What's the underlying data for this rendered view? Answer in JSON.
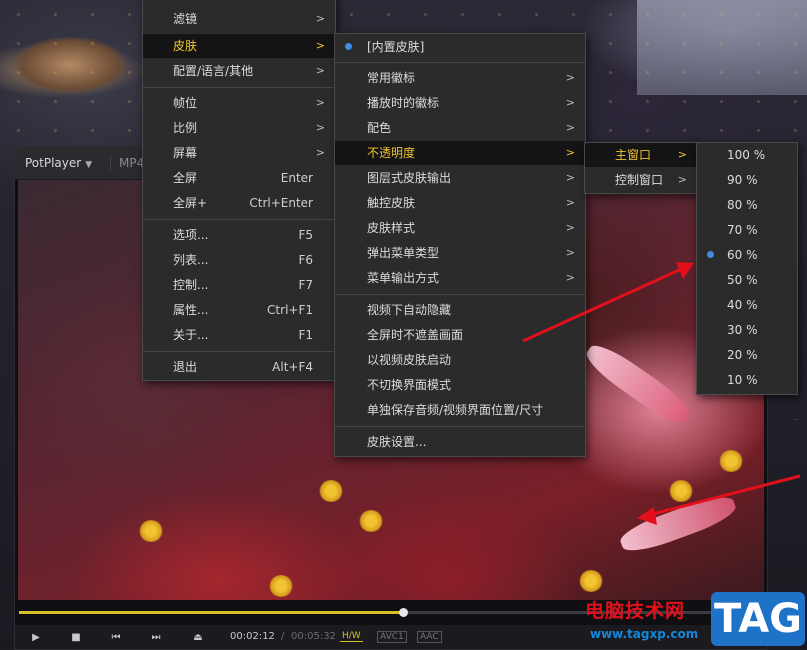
{
  "player": {
    "title": "PotPlayer",
    "format": "MP4",
    "time_current": "00:02:12",
    "time_separator": "/",
    "time_total": "00:05:32",
    "tag_hw": "H/W",
    "tag_video": "AVC1",
    "tag_audio": "AAC",
    "progress_fraction": 0.52
  },
  "main_menu": {
    "items": [
      {
        "label": "滤镜",
        "shortcut": "",
        "submenu": true
      },
      {
        "label": "皮肤",
        "shortcut": "",
        "submenu": true,
        "highlighted": true
      },
      {
        "label": "配置/语言/其他",
        "shortcut": "",
        "submenu": true
      },
      {
        "label": "帧位",
        "shortcut": "",
        "submenu": true
      },
      {
        "label": "比例",
        "shortcut": "",
        "submenu": true
      },
      {
        "label": "屏幕",
        "shortcut": "",
        "submenu": true
      },
      {
        "label": "全屏",
        "shortcut": "Enter",
        "submenu": false
      },
      {
        "label": "全屏+",
        "shortcut": "Ctrl+Enter",
        "submenu": false
      },
      {
        "label": "选项...",
        "shortcut": "F5",
        "submenu": false
      },
      {
        "label": "列表...",
        "shortcut": "F6",
        "submenu": false
      },
      {
        "label": "控制...",
        "shortcut": "F7",
        "submenu": false
      },
      {
        "label": "属性...",
        "shortcut": "Ctrl+F1",
        "submenu": false
      },
      {
        "label": "关于...",
        "shortcut": "F1",
        "submenu": false
      },
      {
        "label": "退出",
        "shortcut": "Alt+F4",
        "submenu": false
      }
    ]
  },
  "skin_menu": {
    "items": [
      {
        "label": "[内置皮肤]",
        "selected": true
      },
      {
        "label": "常用徽标",
        "submenu": true
      },
      {
        "label": "播放时的徽标",
        "submenu": true
      },
      {
        "label": "配色",
        "submenu": true
      },
      {
        "label": "不透明度",
        "submenu": true,
        "highlighted": true
      },
      {
        "label": "图层式皮肤输出",
        "submenu": true
      },
      {
        "label": "触控皮肤",
        "submenu": true
      },
      {
        "label": "皮肤样式",
        "submenu": true
      },
      {
        "label": "弹出菜单类型",
        "submenu": true
      },
      {
        "label": "菜单输出方式",
        "submenu": true
      },
      {
        "label": "视频下自动隐藏"
      },
      {
        "label": "全屏时不遮盖画面"
      },
      {
        "label": "以视频皮肤启动"
      },
      {
        "label": "不切换界面模式"
      },
      {
        "label": "单独保存音频/视频界面位置/尺寸"
      },
      {
        "label": "皮肤设置..."
      }
    ]
  },
  "opacity_menu": {
    "items": [
      {
        "label": "主窗口",
        "submenu": true,
        "highlighted": true
      },
      {
        "label": "控制窗口",
        "submenu": true
      }
    ]
  },
  "percent_menu": {
    "items": [
      {
        "label": "100 %"
      },
      {
        "label": "90 %"
      },
      {
        "label": "80 %"
      },
      {
        "label": "70 %"
      },
      {
        "label": "60 %",
        "selected": true
      },
      {
        "label": "50 %"
      },
      {
        "label": "40 %"
      },
      {
        "label": "30 %"
      },
      {
        "label": "20 %"
      },
      {
        "label": "10 %"
      }
    ]
  },
  "submenu_arrow": ">",
  "colors": {
    "highlight_text": "#f2c230",
    "selected_dot": "#3d8ce6",
    "annotation_arrow": "#e3101b",
    "progress": "#d4c328"
  },
  "watermark": {
    "title": "电脑技术网",
    "url": "www.tagxp.com",
    "badge": "TAG"
  }
}
